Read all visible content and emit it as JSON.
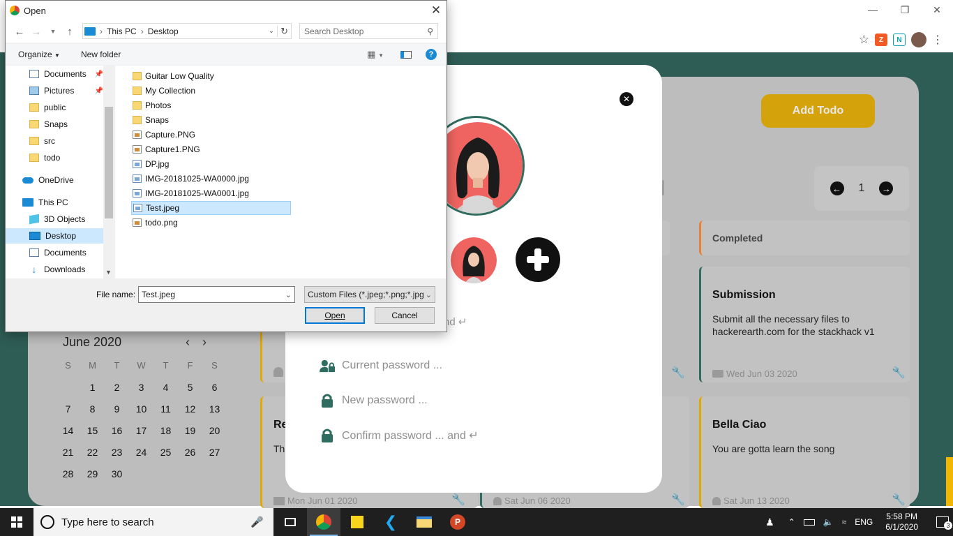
{
  "dialog": {
    "title": "Open",
    "breadcrumb": [
      "This PC",
      "Desktop"
    ],
    "search_placeholder": "Search Desktop",
    "toolbar": {
      "organize": "Organize",
      "new_folder": "New folder"
    },
    "nav_items": [
      {
        "label": "Documents",
        "icon": "documents-icon",
        "pinned": true
      },
      {
        "label": "Pictures",
        "icon": "pictures-icon",
        "pinned": true
      },
      {
        "label": "public",
        "icon": "folder-icon"
      },
      {
        "label": "Snaps",
        "icon": "folder-icon"
      },
      {
        "label": "src",
        "icon": "folder-icon"
      },
      {
        "label": "todo",
        "icon": "folder-icon"
      },
      {
        "label": "OneDrive",
        "icon": "onedrive-icon"
      },
      {
        "label": "This PC",
        "icon": "computer-icon"
      },
      {
        "label": "3D Objects",
        "icon": "3d-objects-icon"
      },
      {
        "label": "Desktop",
        "icon": "desktop-icon",
        "selected": true
      },
      {
        "label": "Documents",
        "icon": "documents-icon"
      },
      {
        "label": "Downloads",
        "icon": "downloads-icon"
      }
    ],
    "files": [
      {
        "name": "Guitar Low Quality",
        "type": "folder"
      },
      {
        "name": "My Collection",
        "type": "folder"
      },
      {
        "name": "Photos",
        "type": "folder"
      },
      {
        "name": "Snaps",
        "type": "folder"
      },
      {
        "name": "Capture.PNG",
        "type": "png"
      },
      {
        "name": "Capture1.PNG",
        "type": "png"
      },
      {
        "name": "DP.jpg",
        "type": "jpg"
      },
      {
        "name": "IMG-20181025-WA0000.jpg",
        "type": "jpg"
      },
      {
        "name": "IMG-20181025-WA0001.jpg",
        "type": "jpg"
      },
      {
        "name": "Test.jpeg",
        "type": "jpg",
        "selected": true
      },
      {
        "name": "todo.png",
        "type": "png"
      }
    ],
    "file_name_label": "File name:",
    "file_name_value": "Test.jpeg",
    "file_type_value": "Custom Files (*.jpeg;*.png;*.jpg",
    "open_label": "Open",
    "cancel_label": "Cancel"
  },
  "app": {
    "add_todo": "Add Todo",
    "page_number": "1",
    "completed_header": "Completed",
    "cards": [
      {
        "title": "Submission",
        "desc": "Submit all the necessary files to hackerearth.com for the stackhack v1",
        "meta": "Wed Jun 03 2020",
        "accent": "#2e6d5f"
      },
      {
        "title": "Bella Ciao",
        "desc": "You are gotta learn the song",
        "meta": "Sat Jun 13 2020",
        "accent": "#e0a800"
      },
      {
        "title": "Re",
        "desc": "Thi",
        "meta": "Mon Jun 01 2020",
        "accent": "#e0a800"
      },
      {
        "meta": "Sat Jun 06 2020"
      }
    ],
    "calendar": {
      "month": "June 2020",
      "dow": [
        "S",
        "M",
        "T",
        "W",
        "T",
        "F",
        "S"
      ],
      "days": [
        "",
        "1",
        "2",
        "3",
        "4",
        "5",
        "6",
        "7",
        "8",
        "9",
        "10",
        "11",
        "12",
        "13",
        "14",
        "15",
        "16",
        "17",
        "18",
        "19",
        "20",
        "21",
        "22",
        "23",
        "24",
        "25",
        "26",
        "27",
        "28",
        "29",
        "30"
      ]
    }
  },
  "modal": {
    "partial_field": "nd ↵",
    "current_password": "Current password ...",
    "new_password": "New password ...",
    "confirm_password": "Confirm password ... and ↵"
  },
  "taskbar": {
    "search_placeholder": "Type here to search",
    "language": "ENG",
    "time": "5:58 PM",
    "date": "6/1/2020",
    "notification_count": "3"
  },
  "colors": {
    "teal": "#2e5d55",
    "accent_yellow": "#d4a20a",
    "selection": "#cce8ff"
  }
}
